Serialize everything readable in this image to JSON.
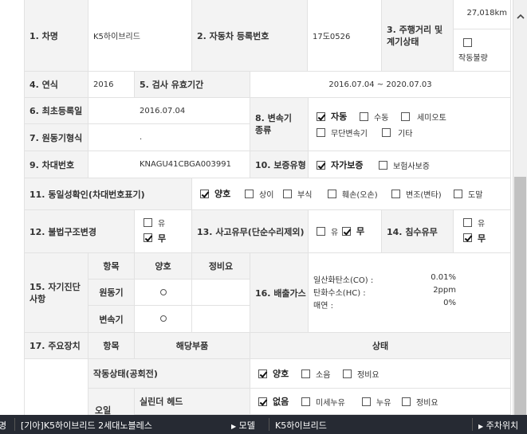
{
  "rows": {
    "r1": {
      "car_name_label": "1. 차명",
      "car_name_value": "K5하이브리드",
      "reg_label": "2. 자동차 등록번호",
      "reg_value": "17도0526",
      "mileage_label": "3. 주행거리 및\n계기상태",
      "mileage_value": "27,018km",
      "gauge_fault_label": "작동불량"
    },
    "r2": {
      "year_label": "4. 연식",
      "year_value": "2016",
      "inspect_label": "5. 검사 유효기간",
      "inspect_value": "2016.07.04 ~ 2020.07.03"
    },
    "r3": {
      "first_reg_label": "6. 최초등록일",
      "first_reg_value": "2016.07.04",
      "trans_label": "8. 변속기\n종류",
      "trans_options": [
        "자동",
        "수동",
        "세미오토",
        "무단변속기",
        "기타"
      ],
      "trans_checked": [
        true,
        false,
        false,
        false,
        false
      ]
    },
    "r4": {
      "motor_label": "7. 원동기형식",
      "motor_value": "."
    },
    "r5": {
      "vin_label": "9. 차대번호",
      "vin_value": "KNAGU41CBGA003991",
      "warranty_label": "10. 보증유형",
      "warranty_options": [
        "자가보증",
        "보험사보증"
      ],
      "warranty_checked": [
        true,
        false
      ]
    },
    "r6": {
      "identity_label": "11. 동일성확인(차대번호표기)",
      "identity_options": [
        "양호",
        "상이",
        "부식",
        "훼손(오손)",
        "변조(변타)",
        "도말"
      ],
      "identity_checked": [
        true,
        false,
        false,
        false,
        false,
        false
      ]
    },
    "r7": {
      "illegal_label": "12. 불법구조변경",
      "yes": "유",
      "no": "무",
      "illegal_checked": [
        false,
        true
      ],
      "accident_label": "13. 사고유무(단순수리제외)",
      "accident_checked": [
        false,
        true
      ],
      "flood_label": "14. 침수유무",
      "flood_checked": [
        false,
        true
      ]
    },
    "r8": {
      "self_diag_label": "15. 자기진단\n사항",
      "col_item": "항목",
      "col_good": "양호",
      "col_repair": "정비요",
      "items": [
        "원동기",
        "변속기"
      ],
      "emission_label": "16. 배출가스",
      "emissions": [
        {
          "name": "일산화탄소(CO) :",
          "value": "0.01%"
        },
        {
          "name": "탄화수소(HC) :",
          "value": "2ppm"
        },
        {
          "name": "매연 :",
          "value": "0%"
        }
      ]
    },
    "r9": {
      "main_label": "17. 주요장치",
      "col_item": "항목",
      "col_part": "해당부품",
      "col_state": "상태"
    },
    "r10": {
      "idle_label": "작동상태(공회전)",
      "idle_options": [
        "양호",
        "소음",
        "정비요"
      ],
      "idle_checked": [
        true,
        false,
        false
      ]
    },
    "r11": {
      "oil_label": "오일",
      "head_label": "실린더 헤드",
      "leak_options": [
        "없음",
        "미세누유",
        "누유",
        "정비요"
      ],
      "leak_checked": [
        true,
        false,
        false,
        false
      ]
    }
  },
  "bottom_bar": {
    "left_cut": "명",
    "car_title": "[기아]K5하이브리드 2세대노블레스",
    "model_label": "모델",
    "model_value": "K5하이브리드",
    "location_label": "주차위치"
  },
  "scrollbar": {
    "up_arrow": "^"
  }
}
